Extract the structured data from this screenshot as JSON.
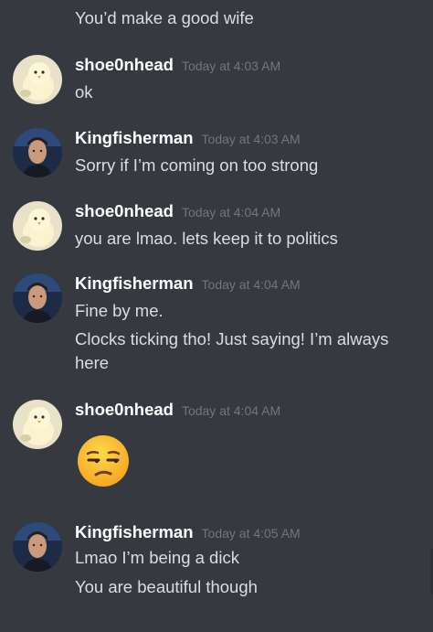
{
  "messages": [
    {
      "kind": "continuation",
      "lines": [
        "You’d make a good wife"
      ]
    },
    {
      "user": "shoe0nhead",
      "time": "Today at 4:03 AM",
      "avatar": "chick-avatar",
      "lines": [
        "ok"
      ]
    },
    {
      "user": "Kingfisherman",
      "time": "Today at 4:03 AM",
      "avatar": "man-avatar",
      "lines": [
        "Sorry if I’m coming on too strong"
      ]
    },
    {
      "user": "shoe0nhead",
      "time": "Today at 4:04 AM",
      "avatar": "chick-avatar",
      "lines": [
        "you are lmao. lets keep it to politics"
      ]
    },
    {
      "user": "Kingfisherman",
      "time": "Today at 4:04 AM",
      "avatar": "man-avatar",
      "lines": [
        "Fine by me.",
        "Clocks ticking tho! Just saying! I’m always",
        "here"
      ]
    },
    {
      "user": "shoe0nhead",
      "time": "Today at 4:04 AM",
      "avatar": "chick-avatar",
      "emoji": "unamused-face-emoji"
    },
    {
      "user": "Kingfisherman",
      "time": "Today at 4:05 AM",
      "avatar": "man-avatar",
      "lines": [
        "Lmao I’m being a dick",
        "You are beautiful though"
      ]
    }
  ],
  "colors": {
    "background": "#36393f",
    "username": "#ffffff",
    "timestamp": "#72767d",
    "text": "#dcddde"
  }
}
